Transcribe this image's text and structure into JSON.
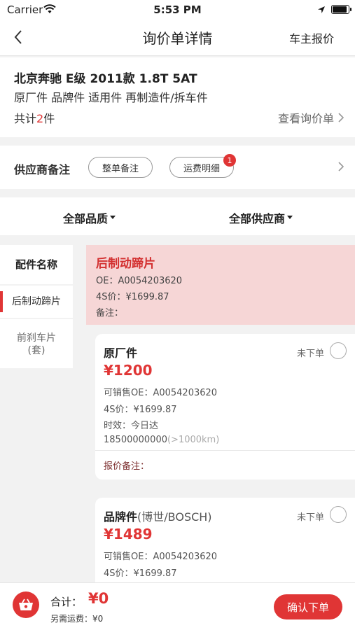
{
  "status_bar": {
    "carrier": "Carrier",
    "time": "5:53 PM"
  },
  "nav": {
    "title": "询价单详情",
    "right_action": "车主报价"
  },
  "car": {
    "name": "北京奔驰 E级 2011款 1.8T 5AT",
    "part_types": "原厂件 品牌件 适用件 再制造件/拆车件",
    "total_prefix": "共计",
    "total_count": "2",
    "total_suffix": "件",
    "view_link": "查看询价单"
  },
  "remarks": {
    "label": "供应商备注",
    "btn_order_note": "整单备注",
    "btn_freight": "运费明细",
    "freight_badge": "1"
  },
  "filters": {
    "quality": "全部品质",
    "supplier": "全部供应商"
  },
  "sidebar": {
    "header": "配件名称",
    "items": [
      {
        "label": "后制动蹄片"
      },
      {
        "label_line1": "前刹车片",
        "label_line2": "(套)"
      }
    ]
  },
  "part": {
    "name": "后制动蹄片",
    "oe": "OE：A0054203620",
    "price_4s": "4S价：¥1699.87",
    "note": "备注："
  },
  "offers": [
    {
      "title": "原厂件",
      "brand": "",
      "status": "未下单",
      "price": "¥1200",
      "oe": "可销售OE：A0054203620",
      "price_4s": "4S价：¥1699.87",
      "timing": "时效：今日达",
      "phone": "18500000000",
      "distance": "(>1000km)",
      "quote_note": "报价备注："
    },
    {
      "title": "品牌件",
      "brand": "(博世/BOSCH)",
      "status": "未下单",
      "price": "¥1489",
      "oe": "可销售OE：A0054203620",
      "price_4s": "4S价：¥1699.87"
    }
  ],
  "bottom": {
    "sum_label": "合计：",
    "sum_value": "¥0",
    "fee": "另需运费：¥0",
    "confirm": "确认下单"
  },
  "colors": {
    "accent": "#e03535",
    "part_head_bg": "#f6d6d6"
  }
}
